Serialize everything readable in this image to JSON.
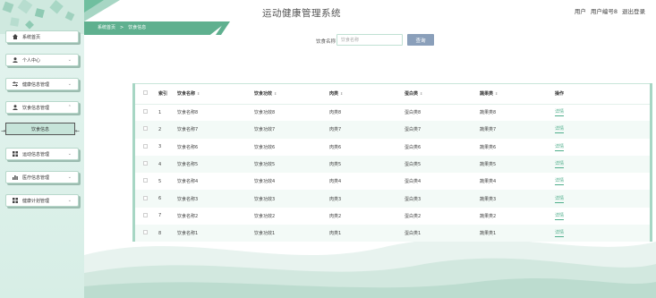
{
  "header": {
    "title": "运动健康管理系统",
    "user_role": "用户",
    "user_name": "用户编号8",
    "logout": "退出登录"
  },
  "breadcrumb": {
    "home": "系统首页",
    "separator": ">",
    "current": "饮食信息"
  },
  "search": {
    "label": "饮食名称",
    "placeholder": "饮食名称",
    "button": "查询"
  },
  "sidebar": {
    "items": [
      {
        "label": "系统首页",
        "icon": "home-icon"
      },
      {
        "label": "个人中心",
        "icon": "user-icon"
      },
      {
        "label": "健康信息管理",
        "icon": "sliders-icon"
      },
      {
        "label": "饮食信息管理",
        "icon": "user-icon"
      },
      {
        "label": "运动信息管理",
        "icon": "grid-icon"
      },
      {
        "label": "医疗信息管理",
        "icon": "bar-chart-icon"
      },
      {
        "label": "健康计划管理",
        "icon": "grid-icon"
      }
    ],
    "subitem": "饮食信息"
  },
  "table": {
    "headers": [
      "索引",
      "饮食名称",
      "饮食功效",
      "肉类",
      "蛋白类",
      "蔬果类",
      "操作"
    ],
    "rows": [
      {
        "idx": "1",
        "name": "饮食名称8",
        "effect": "饮食功效8",
        "meat": "肉类8",
        "protein": "蛋白类8",
        "veg": "蔬果类8",
        "action": "详情"
      },
      {
        "idx": "2",
        "name": "饮食名称7",
        "effect": "饮食功效7",
        "meat": "肉类7",
        "protein": "蛋白类7",
        "veg": "蔬果类7",
        "action": "详情"
      },
      {
        "idx": "3",
        "name": "饮食名称6",
        "effect": "饮食功效6",
        "meat": "肉类6",
        "protein": "蛋白类6",
        "veg": "蔬果类6",
        "action": "详情"
      },
      {
        "idx": "4",
        "name": "饮食名称5",
        "effect": "饮食功效5",
        "meat": "肉类5",
        "protein": "蛋白类5",
        "veg": "蔬果类5",
        "action": "详情"
      },
      {
        "idx": "5",
        "name": "饮食名称4",
        "effect": "饮食功效4",
        "meat": "肉类4",
        "protein": "蛋白类4",
        "veg": "蔬果类4",
        "action": "详情"
      },
      {
        "idx": "6",
        "name": "饮食名称3",
        "effect": "饮食功效3",
        "meat": "肉类3",
        "protein": "蛋白类3",
        "veg": "蔬果类3",
        "action": "详情"
      },
      {
        "idx": "7",
        "name": "饮食名称2",
        "effect": "饮食功效2",
        "meat": "肉类2",
        "protein": "蛋白类2",
        "veg": "蔬果类2",
        "action": "详情"
      },
      {
        "idx": "8",
        "name": "饮食名称1",
        "effect": "饮食功效1",
        "meat": "肉类1",
        "protein": "蛋白类1",
        "veg": "蔬果类1",
        "action": "详情"
      }
    ]
  },
  "colors": {
    "accent": "#5fb08f",
    "search_button": "#8a9fba",
    "sidebar_bg": "#e4f4ef"
  }
}
